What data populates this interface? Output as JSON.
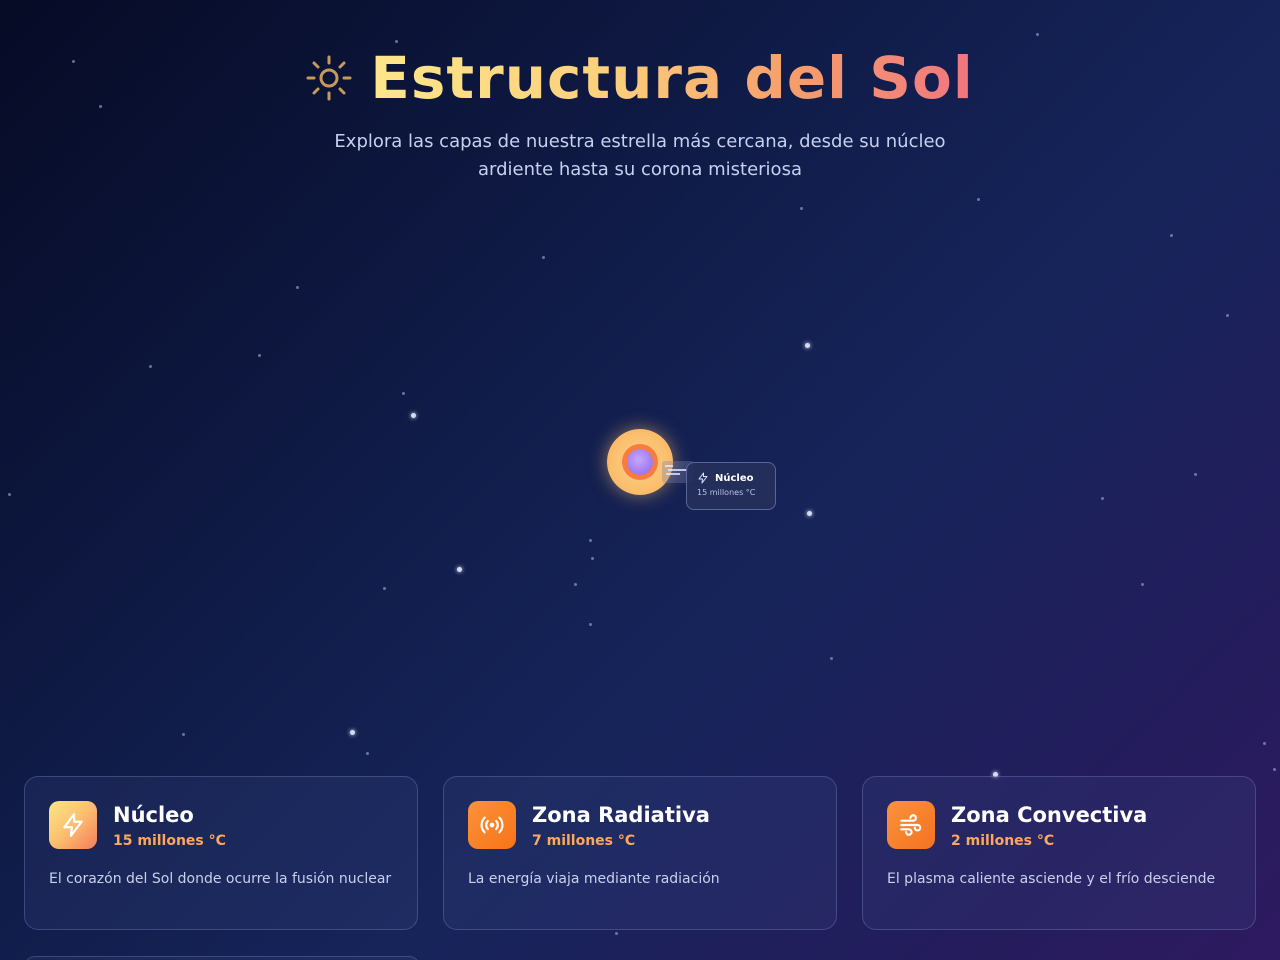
{
  "header": {
    "icon": "sun-icon",
    "title": "Estructura del Sol",
    "subtitle": "Explora las capas de nuestra estrella más cercana, desde su núcleo ardiente hasta su corona misteriosa"
  },
  "diagram": {
    "tooltip": {
      "icon": "lightning-icon",
      "title": "Núcleo",
      "temperature": "15 millones °C"
    }
  },
  "layers": [
    {
      "icon": "lightning-icon",
      "title": "Núcleo",
      "temperature": "15 millones °C",
      "description": "El corazón del Sol donde ocurre la fusión nuclear"
    },
    {
      "icon": "radiation-icon",
      "title": "Zona Radiativa",
      "temperature": "7 millones °C",
      "description": "La energía viaja mediante radiación"
    },
    {
      "icon": "wind-icon",
      "title": "Zona Convectiva",
      "temperature": "2 millones °C",
      "description": "El plasma caliente asciende y el frío desciende"
    }
  ],
  "colors": {
    "accent_orange": "#f97316",
    "temperature_text": "#fca65e",
    "background_dark": "#060b25"
  }
}
